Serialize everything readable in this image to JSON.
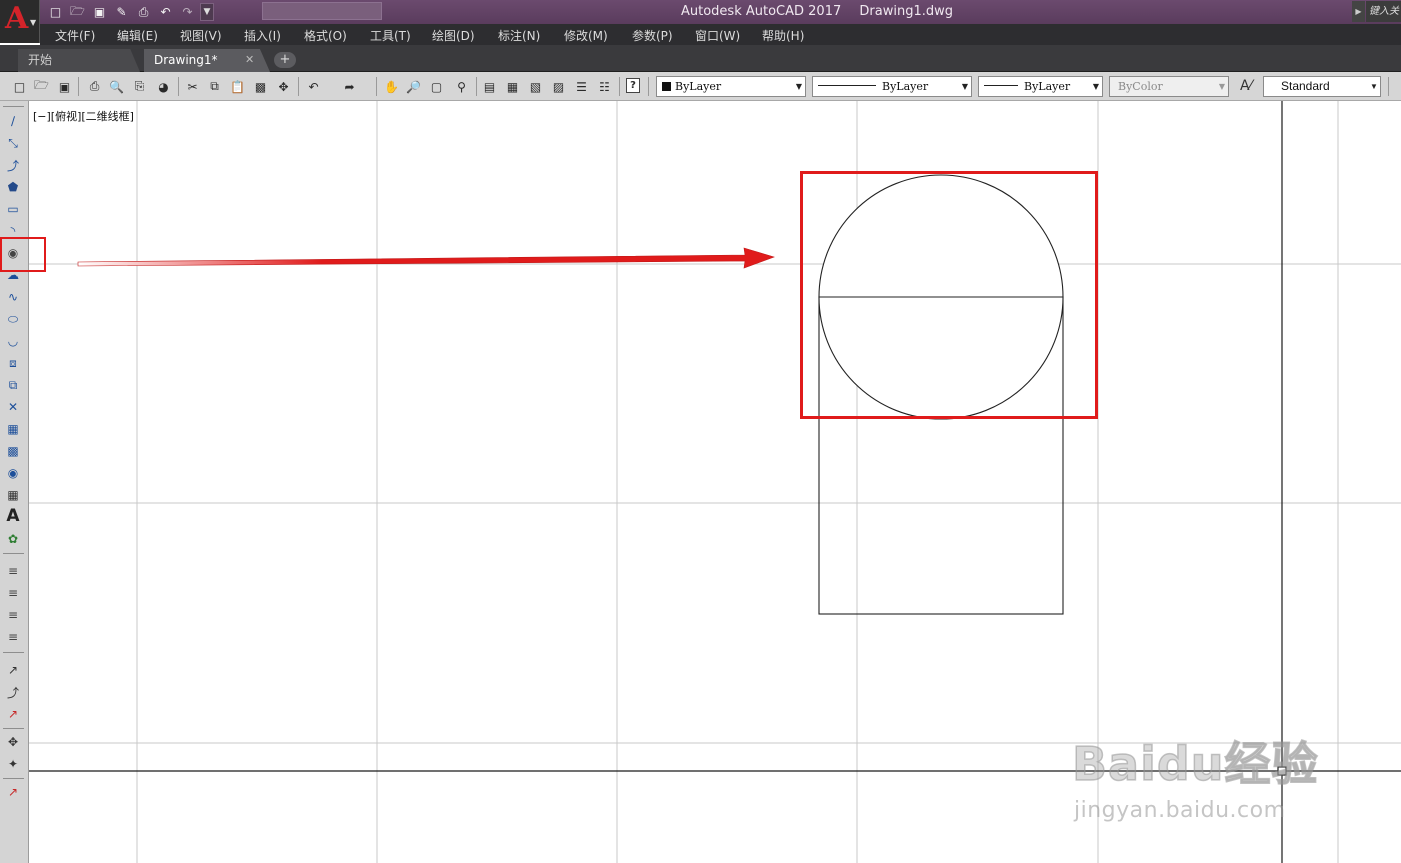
{
  "app": {
    "title": "Autodesk AutoCAD 2017",
    "file": "Drawing1.dwg",
    "logo_letter": "A",
    "search_placeholder": "键入关"
  },
  "quick_access": [
    {
      "icon": "new-icon"
    },
    {
      "icon": "open-icon"
    },
    {
      "icon": "save-icon"
    },
    {
      "icon": "save-as-icon"
    },
    {
      "icon": "print-icon"
    },
    {
      "icon": "undo-icon"
    },
    {
      "icon": "redo-icon"
    }
  ],
  "menu": [
    "文件(F)",
    "编辑(E)",
    "视图(V)",
    "插入(I)",
    "格式(O)",
    "工具(T)",
    "绘图(D)",
    "标注(N)",
    "修改(M)",
    "参数(P)",
    "窗口(W)",
    "帮助(H)"
  ],
  "tabs": {
    "start": "开始",
    "drawing": "Drawing1*",
    "close_glyph": "✕",
    "add_glyph": "+"
  },
  "properties": {
    "color": "ByLayer",
    "linetype": "ByLayer",
    "lineweight": "ByLayer",
    "plotstyle": "ByColor",
    "textstyle": "Standard"
  },
  "viewport_label": "[−][俯视][二维线框]",
  "colors": {
    "titlebar": "#5a3c5d",
    "menubar": "#2d2d30",
    "toolbar": "#d6d6d6",
    "canvas": "#ffffff",
    "grid": "#c8c8c8",
    "annotation": "#e01b1b",
    "logo": "#d4242a"
  },
  "watermark": {
    "logo": "Baidu经验",
    "url": "jingyan.baidu.com"
  },
  "draw_tools": [
    "line-icon",
    "construction-line-icon",
    "polyline-icon",
    "polygon-icon",
    "rectangle-icon",
    "arc-icon",
    "circle-icon",
    "revision-cloud-icon",
    "spline-icon",
    "ellipse-icon",
    "ellipse-arc-icon",
    "insert-block-icon",
    "make-block-icon",
    "point-icon",
    "hatch-icon",
    "gradient-icon",
    "region-icon",
    "table-icon",
    "multiline-text-icon",
    "add-selected-icon"
  ]
}
